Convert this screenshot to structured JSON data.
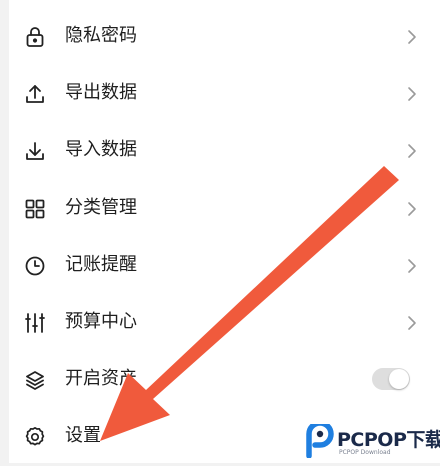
{
  "menu": {
    "items": [
      {
        "label": "隐私密码",
        "icon": "lock-icon"
      },
      {
        "label": "导出数据",
        "icon": "upload-icon"
      },
      {
        "label": "导入数据",
        "icon": "download-icon"
      },
      {
        "label": "分类管理",
        "icon": "grid-icon"
      },
      {
        "label": "记账提醒",
        "icon": "clock-icon"
      },
      {
        "label": "预算中心",
        "icon": "sliders-icon"
      },
      {
        "label": "开启资产",
        "icon": "layers-icon",
        "toggle": false
      },
      {
        "label": "设置",
        "icon": "gear-icon"
      }
    ]
  },
  "overlay": {
    "arrow_color": "#f05a3c",
    "icon": "arrow-pointer-icon"
  },
  "watermark": {
    "brand": "PCPOP下载",
    "tagline": "PCPOP Download",
    "color": "#1b2a4a",
    "accent": "#1f7fe0"
  }
}
